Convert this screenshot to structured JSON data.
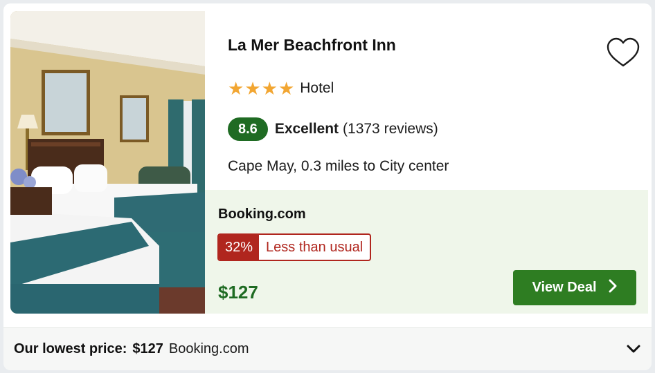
{
  "hotel": {
    "name": "La Mer Beachfront Inn",
    "stars": 4,
    "type": "Hotel",
    "rating_score": "8.6",
    "rating_word": "Excellent",
    "reviews": "(1373 reviews)",
    "location": "Cape May, 0.3 miles to City center",
    "image_description": "hotel-room-photo"
  },
  "deal": {
    "provider": "Booking.com",
    "discount_pct": "32%",
    "discount_text": "Less than usual",
    "price": "$127",
    "button_label": "View Deal"
  },
  "footer": {
    "label": "Our lowest price:",
    "price": "$127",
    "provider": "Booking.com"
  },
  "icons": {
    "favorite": "heart-outline-icon",
    "star": "star-icon",
    "button_arrow": "chevron-right-icon",
    "expand": "chevron-down-icon"
  },
  "colors": {
    "rating_badge": "#1f6b23",
    "star": "#f2a632",
    "discount": "#b0261e",
    "price": "#1f6b23",
    "button": "#2e7d22",
    "deal_background": "#eff6ea"
  }
}
